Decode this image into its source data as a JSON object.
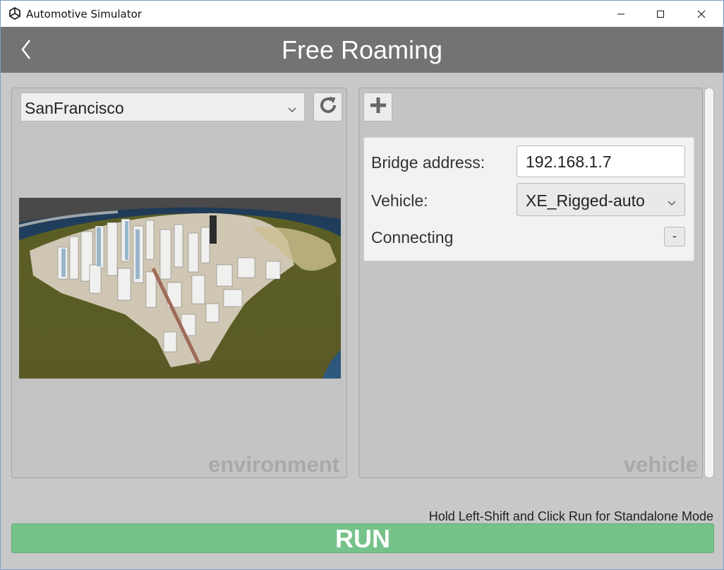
{
  "window": {
    "title": "Automotive Simulator",
    "app_icon": "unity-logo-icon",
    "controls": [
      "minimize-icon",
      "maximize-icon",
      "close-icon"
    ]
  },
  "header": {
    "title": "Free Roaming",
    "back_icon": "chevron-left-icon"
  },
  "environment_panel": {
    "selected_map": "SanFrancisco",
    "refresh_icon": "refresh-icon",
    "preview_image": "city-map-preview",
    "watermark": "environment"
  },
  "vehicle_panel": {
    "add_icon": "plus-icon",
    "bridge_label": "Bridge address:",
    "bridge_value": "192.168.1.7",
    "vehicle_label": "Vehicle:",
    "vehicle_value": "XE_Rigged-auto",
    "status_label": "Connecting",
    "remove_label": "-",
    "watermark": "vehicle"
  },
  "footer": {
    "hint": "Hold Left-Shift and Click Run for Standalone Mode",
    "run_label": "RUN"
  },
  "colors": {
    "header_bg": "#737373",
    "panel_bg": "#c4c4c4",
    "run_bg": "#75c28a"
  }
}
